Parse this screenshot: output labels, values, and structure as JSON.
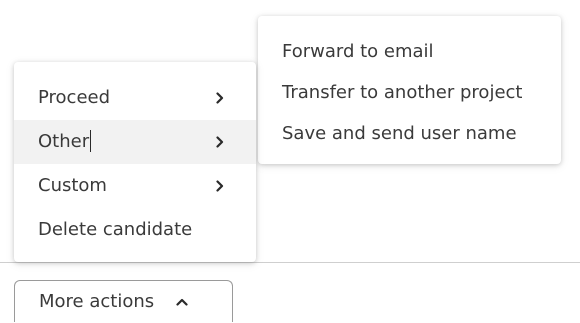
{
  "menu": {
    "items": [
      {
        "label": "Proceed",
        "has_submenu": true
      },
      {
        "label": "Other",
        "has_submenu": true,
        "hovered": true
      },
      {
        "label": "Custom",
        "has_submenu": true
      },
      {
        "label": "Delete candidate",
        "has_submenu": false
      }
    ]
  },
  "submenu": {
    "items": [
      {
        "label": "Forward to email"
      },
      {
        "label": "Transfer to another project"
      },
      {
        "label": "Save and send user name"
      }
    ]
  },
  "footer": {
    "more_actions_label": "More actions"
  },
  "icons": {
    "submenu_arrow": "chevron-right-icon",
    "button_arrow": "chevron-up-icon"
  },
  "colors": {
    "hover_background": "#f2f2f2",
    "text": "#3a3a3a",
    "divider": "#cfcfcf",
    "button_border": "#9a9a9a"
  }
}
